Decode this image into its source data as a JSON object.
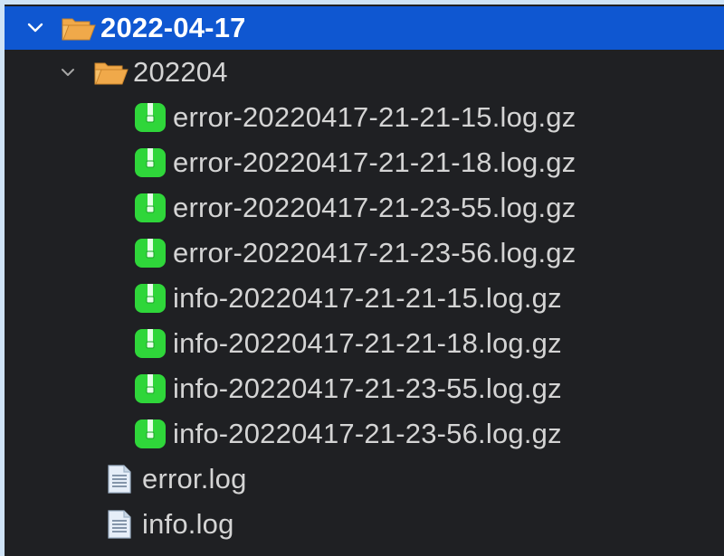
{
  "tree": {
    "root": {
      "label": "2022-04-17",
      "expanded": true,
      "children_folder": {
        "label": "202204",
        "expanded": true,
        "files": [
          "error-20220417-21-21-15.log.gz",
          "error-20220417-21-21-18.log.gz",
          "error-20220417-21-23-55.log.gz",
          "error-20220417-21-23-56.log.gz",
          "info-20220417-21-21-15.log.gz",
          "info-20220417-21-21-18.log.gz",
          "info-20220417-21-23-55.log.gz",
          "info-20220417-21-23-56.log.gz"
        ]
      },
      "files": [
        "error.log",
        "info.log"
      ]
    }
  },
  "colors": {
    "selection": "#0f57d1",
    "background": "#1f2023",
    "folder": "#f0a94a",
    "archive": "#2fd63a",
    "text": "#d4d4d4"
  },
  "icons": {
    "chevron": "chevron-down-icon",
    "folder": "open-folder-icon",
    "archive": "gz-archive-icon",
    "document": "log-file-icon"
  }
}
